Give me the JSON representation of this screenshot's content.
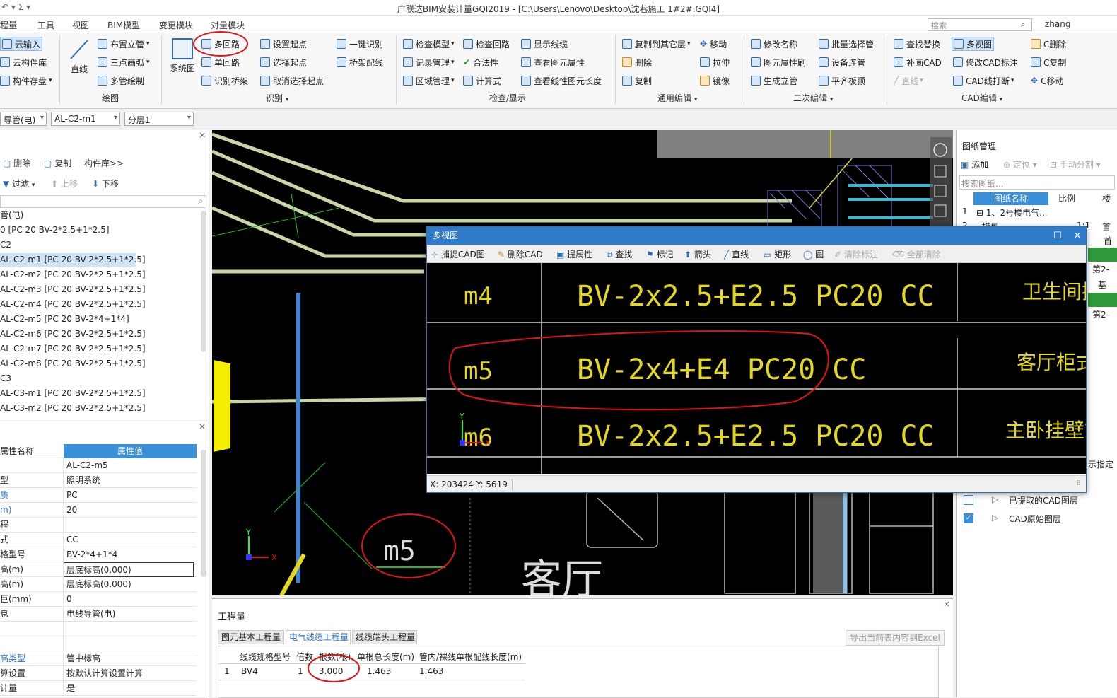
{
  "window": {
    "title": "广联达BIM安装计量GQI2019 - [C:\\Users\\Lenovo\\Desktop\\沈巷施工 1#2#.GQI4]",
    "quick_access": "↶ ▾  Σ  ▾",
    "search_placeholder": "搜索",
    "user": "zhang"
  },
  "menu": [
    "程量",
    "工具",
    "视图",
    "BIM模型",
    "变更模块",
    "对量模块"
  ],
  "ribbon": {
    "col1": [
      "云输入",
      "云构件库",
      "构件存盘"
    ],
    "draw": {
      "big": "直线",
      "items": [
        "布置立管",
        "三点画弧",
        "多管绘制"
      ],
      "group": "绘图"
    },
    "identify": {
      "big": "系统图",
      "items": [
        "多回路",
        "单回路",
        "识别桥架",
        "设置起点",
        "选择起点",
        "取消选择起点",
        "一键识别",
        "桥架配线"
      ],
      "group": "识别"
    },
    "check": {
      "items": [
        "检查模型",
        "记录管理",
        "区域管理",
        "检查回路",
        "合法性",
        "计算式",
        "显示线缆",
        "查看图元属性",
        "查看线性图元长度"
      ],
      "group": "检查/显示"
    },
    "edit": {
      "items": [
        "复制到其它层",
        "删除",
        "复制",
        "移动",
        "拉伸",
        "镜像"
      ],
      "group": "通用编辑"
    },
    "edit2": {
      "items": [
        "修改名称",
        "图元属性刷",
        "生成立管",
        "批量选择管",
        "设备连管",
        "平齐板顶"
      ],
      "group": "二次编辑"
    },
    "cad": {
      "items": [
        "查找替换",
        "补画CAD",
        "直线",
        "多视图",
        "修改CAD标注",
        "CAD线打断",
        "C删除",
        "C复制",
        "C移动"
      ],
      "group": "CAD编辑"
    }
  },
  "combos": [
    "导管(电)",
    "AL-C2-m1",
    "分层1"
  ],
  "left_panel": {
    "toolbar": [
      "删除",
      "复制",
      "构件库>>",
      "过滤",
      "上移",
      "下移"
    ],
    "tree": [
      "管(电)",
      "0 [PC 20 BV-2*2.5+1*2.5]",
      "C2",
      "AL-C2-m1 [PC 20 BV-2*2.5+1*2.5]",
      "AL-C2-m2 [PC 20 BV-2*2.5+1*2.5]",
      "AL-C2-m3 [PC 20 BV-2*2.5+1*2.5]",
      "AL-C2-m4 [PC 20 BV-2*2.5+1*2.5]",
      "AL-C2-m5 [PC 20 BV-2*4+1*4]",
      "AL-C2-m6 [PC 20 BV-2*2.5+1*2.5]",
      "AL-C2-m7 [PC 20 BV-2*2.5+1*2.5]",
      "AL-C2-m8 [PC 20 BV-2*2.5+1*2.5]",
      "C3",
      "AL-C3-m1 [PC 20 BV-2*2.5+1*2.5]",
      "AL-C3-m2 [PC 20 BV-2*2.5+1*2.5]"
    ]
  },
  "properties": {
    "header": [
      "属性名称",
      "属性值"
    ],
    "rows": [
      [
        "",
        "AL-C2-m5"
      ],
      [
        "型",
        "照明系统"
      ],
      [
        "质",
        "PC"
      ],
      [
        "m)",
        "20"
      ],
      [
        "程",
        ""
      ],
      [
        "式",
        "CC"
      ],
      [
        "格型号",
        "BV-2*4+1*4"
      ],
      [
        "高(m)",
        "层底标高(0.000)"
      ],
      [
        "高(m)",
        "层底标高(0.000)"
      ],
      [
        "巨(mm)",
        "0"
      ],
      [
        "息",
        "电线导管(电)"
      ],
      [
        "",
        ""
      ],
      [
        "",
        ""
      ],
      [
        "高类型",
        "管中标高"
      ],
      [
        "算设置",
        "按默认计算设置计算"
      ],
      [
        "计量",
        "是"
      ]
    ]
  },
  "canvas": {
    "label_m5": "m5",
    "label_room": "客厅"
  },
  "dialog": {
    "title": "多视图",
    "toolbar": [
      "捕捉CAD图",
      "删除CAD",
      "提属性",
      "查找",
      "标记",
      "箭头",
      "直线",
      "矩形",
      "圆",
      "清除标注",
      "全部清除"
    ],
    "rows": [
      {
        "code": "m4",
        "spec": "BV-2x2.5+E2.5 PC20 CC",
        "desc": "卫生间插座"
      },
      {
        "code": "m5",
        "spec": "BV-2x4+E4 PC20 CC",
        "desc": "客厅柜式空调"
      },
      {
        "code": "m6",
        "spec": "BV-2x2.5+E2.5 PC20 CC",
        "desc": "主卧挂壁式空调"
      }
    ],
    "status": "X: 203424  Y: 5619"
  },
  "quantity": {
    "title": "工程量",
    "tabs": [
      "图元基本工程量",
      "电气线缆工程量",
      "线缆端头工程量"
    ],
    "export": "导出当前表内容到Excel",
    "columns": [
      "线缆规格型号",
      "倍数",
      "根数(根)",
      "单根总长度(m)",
      "管内/裸线单根配线长度(m)"
    ],
    "row": [
      "1",
      "BV4",
      "1",
      "3.000",
      "1.463",
      "1.463"
    ]
  },
  "right_panel": {
    "title": "图纸管理",
    "toolbar": [
      "添加",
      "定位",
      "手动分割"
    ],
    "search_placeholder": "搜索图纸...",
    "columns": [
      "图纸名称",
      "比例",
      "楼"
    ],
    "rows": [
      [
        "1",
        "1、2号楼电气...",
        "",
        ""
      ],
      [
        "2",
        "模型",
        "1:1",
        "首"
      ]
    ],
    "side_labels": [
      "首",
      "基",
      "第2-",
      "基",
      "第2-"
    ],
    "hint": "示指定",
    "layers": [
      "已提取的CAD图层",
      "CAD原始图层"
    ]
  },
  "colors": {
    "accent": "#2f7bc9",
    "cad_yellow": "#e4d81c",
    "annotation_red": "#e01515"
  }
}
